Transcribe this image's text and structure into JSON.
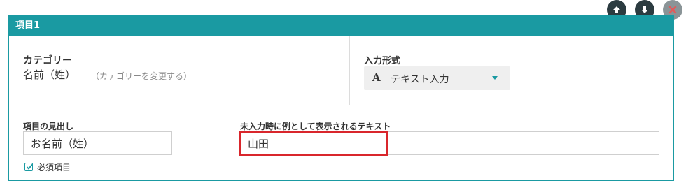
{
  "panel": {
    "title": "項目1"
  },
  "toolbar": {
    "up_icon": "arrow-up-icon",
    "down_icon": "arrow-down-icon",
    "delete_icon": "close-icon"
  },
  "category": {
    "label": "カテゴリー",
    "value": "名前（姓）",
    "change_link": "（カテゴリーを変更する）"
  },
  "input_type": {
    "label": "入力形式",
    "icon_glyph": "A",
    "selected": "テキスト入力"
  },
  "heading_field": {
    "label": "項目の見出し",
    "value": "お名前（姓）"
  },
  "placeholder_field": {
    "label": "未入力時に例として表示されるテキスト",
    "value": "山田"
  },
  "required": {
    "label": "必須項目",
    "checked": true
  },
  "colors": {
    "accent": "#1a9aa2",
    "highlight": "#d9262c",
    "button_dark": "#2b3b40",
    "button_gray": "#8a9497"
  }
}
